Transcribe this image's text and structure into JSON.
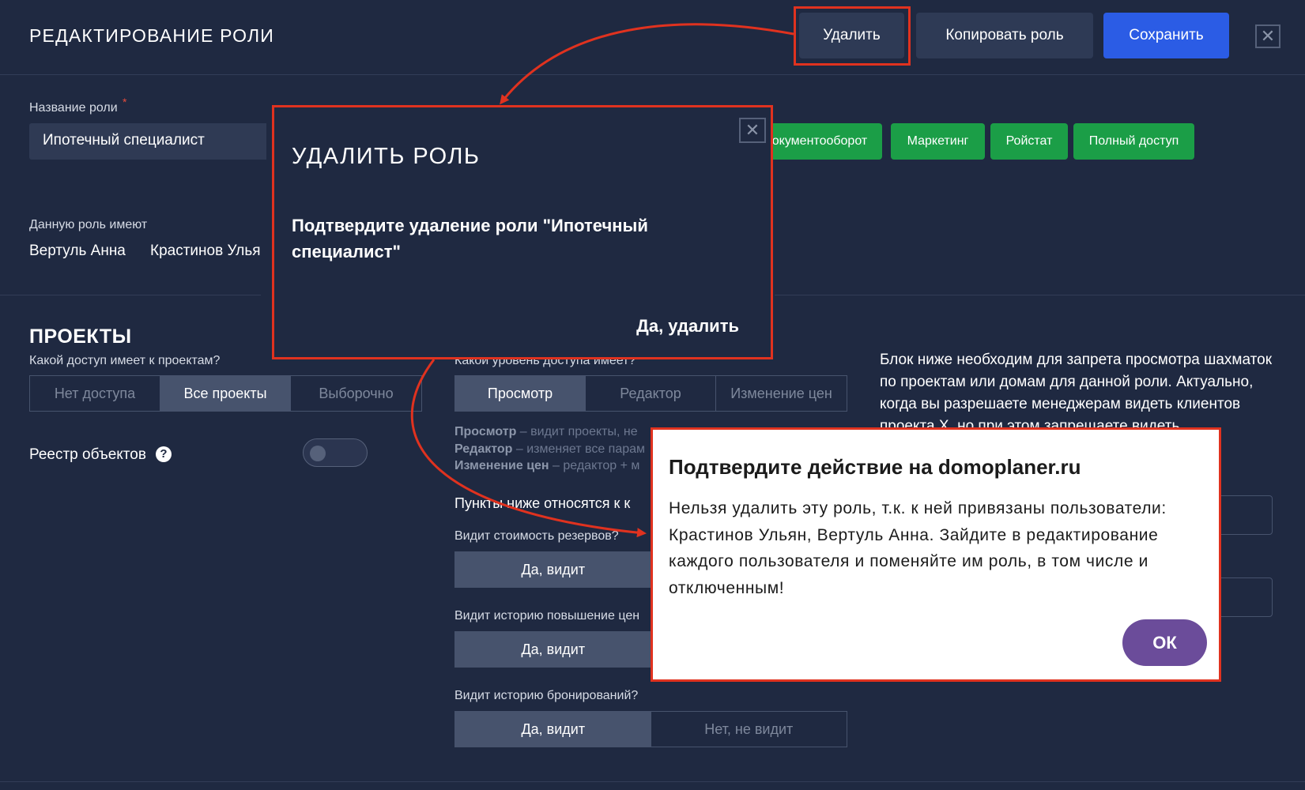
{
  "header": {
    "title": "РЕДАКТИРОВАНИЕ РОЛИ",
    "delete_label": "Удалить",
    "copy_label": "Копировать роль",
    "save_label": "Сохранить",
    "close_label": "✕"
  },
  "role": {
    "name_label": "Название роли",
    "required_mark": "*",
    "name_value": "Ипотечный специалист",
    "tags": [
      "окументооборот",
      "Маркетинг",
      "Ройстат",
      "Полный доступ"
    ],
    "holders_label": "Данную роль имеют",
    "holders": [
      "Вертуль Анна",
      "Крастинов Ульян"
    ]
  },
  "projects": {
    "title": "ПРОЕКТЫ",
    "question": "Какой доступ имеет к проектам?",
    "options": [
      "Нет доступа",
      "Все проекты",
      "Выборочно"
    ],
    "selected": "Все проекты",
    "registry_label": "Реестр объектов",
    "registry_help_icon": "?",
    "registry_enabled": false
  },
  "access": {
    "question": "Какой уровень доступа имеет?",
    "options": [
      "Просмотр",
      "Редактор",
      "Изменение цен"
    ],
    "selected": "Просмотр",
    "desc_1_term": "Просмотр",
    "desc_1_text": " – видит проекты, не",
    "desc_2_term": "Редактор",
    "desc_2_text": " – изменяет все парам",
    "desc_3_term": "Изменение цен",
    "desc_3_text": " – редактор + м",
    "points_label": "Пункты ниже относятся к к",
    "q1_label": "Видит стоимость резервов?",
    "q1_yes": "Да, видит",
    "q2_label": "Видит историю повышение цен",
    "q2_yes": "Да, видит",
    "q3_label": "Видит историю бронирований?",
    "q3_yes": "Да, видит",
    "q3_no": "Нет, не видит"
  },
  "info": {
    "text": "Блок ниже необходим для запрета просмотра шахматок по проектам или домам для данной роли. Актуально, когда вы разрешаете менеджерам видеть клиентов проекта X, но при этом запрещаете видеть"
  },
  "delete_dialog": {
    "title": "УДАЛИТЬ РОЛЬ",
    "text": "Подтвердите удаление роли \"Ипотечный специалист\"",
    "confirm_label": "Да, удалить",
    "close_label": "✕"
  },
  "browser_confirm": {
    "title": "Подтвердите действие на domoplaner.ru",
    "text": "Нельзя удалить эту роль, т.к. к ней привязаны пользователи: Крастинов Ульян, Вертуль Анна. Зайдите в редактирование каждого пользователя и поменяйте им роль, в том числе и отключенным!",
    "ok_label": "ОК",
    "ok_color": "#6b4c9a"
  },
  "colors": {
    "background": "#1f2941",
    "accent_blue": "#2b5ce5",
    "green_tag": "#1b9e47",
    "annotation_red": "#e0321f"
  }
}
